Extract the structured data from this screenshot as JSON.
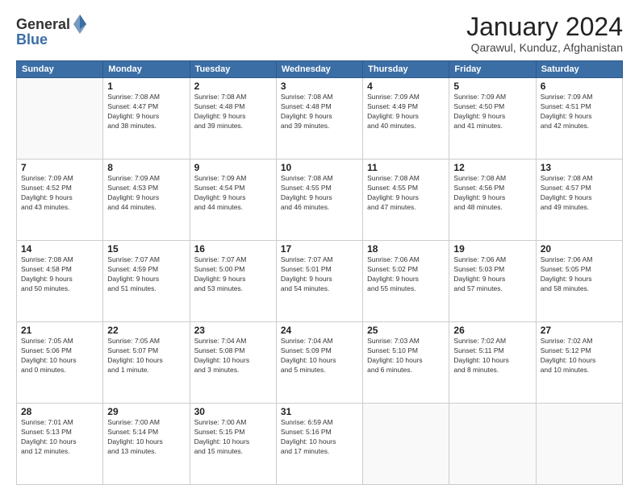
{
  "logo": {
    "general": "General",
    "blue": "Blue"
  },
  "title": "January 2024",
  "subtitle": "Qarawul, Kunduz, Afghanistan",
  "days_of_week": [
    "Sunday",
    "Monday",
    "Tuesday",
    "Wednesday",
    "Thursday",
    "Friday",
    "Saturday"
  ],
  "weeks": [
    [
      {
        "day": "",
        "info": ""
      },
      {
        "day": "1",
        "info": "Sunrise: 7:08 AM\nSunset: 4:47 PM\nDaylight: 9 hours\nand 38 minutes."
      },
      {
        "day": "2",
        "info": "Sunrise: 7:08 AM\nSunset: 4:48 PM\nDaylight: 9 hours\nand 39 minutes."
      },
      {
        "day": "3",
        "info": "Sunrise: 7:08 AM\nSunset: 4:48 PM\nDaylight: 9 hours\nand 39 minutes."
      },
      {
        "day": "4",
        "info": "Sunrise: 7:09 AM\nSunset: 4:49 PM\nDaylight: 9 hours\nand 40 minutes."
      },
      {
        "day": "5",
        "info": "Sunrise: 7:09 AM\nSunset: 4:50 PM\nDaylight: 9 hours\nand 41 minutes."
      },
      {
        "day": "6",
        "info": "Sunrise: 7:09 AM\nSunset: 4:51 PM\nDaylight: 9 hours\nand 42 minutes."
      }
    ],
    [
      {
        "day": "7",
        "info": "Sunrise: 7:09 AM\nSunset: 4:52 PM\nDaylight: 9 hours\nand 43 minutes."
      },
      {
        "day": "8",
        "info": "Sunrise: 7:09 AM\nSunset: 4:53 PM\nDaylight: 9 hours\nand 44 minutes."
      },
      {
        "day": "9",
        "info": "Sunrise: 7:09 AM\nSunset: 4:54 PM\nDaylight: 9 hours\nand 44 minutes."
      },
      {
        "day": "10",
        "info": "Sunrise: 7:08 AM\nSunset: 4:55 PM\nDaylight: 9 hours\nand 46 minutes."
      },
      {
        "day": "11",
        "info": "Sunrise: 7:08 AM\nSunset: 4:55 PM\nDaylight: 9 hours\nand 47 minutes."
      },
      {
        "day": "12",
        "info": "Sunrise: 7:08 AM\nSunset: 4:56 PM\nDaylight: 9 hours\nand 48 minutes."
      },
      {
        "day": "13",
        "info": "Sunrise: 7:08 AM\nSunset: 4:57 PM\nDaylight: 9 hours\nand 49 minutes."
      }
    ],
    [
      {
        "day": "14",
        "info": "Sunrise: 7:08 AM\nSunset: 4:58 PM\nDaylight: 9 hours\nand 50 minutes."
      },
      {
        "day": "15",
        "info": "Sunrise: 7:07 AM\nSunset: 4:59 PM\nDaylight: 9 hours\nand 51 minutes."
      },
      {
        "day": "16",
        "info": "Sunrise: 7:07 AM\nSunset: 5:00 PM\nDaylight: 9 hours\nand 53 minutes."
      },
      {
        "day": "17",
        "info": "Sunrise: 7:07 AM\nSunset: 5:01 PM\nDaylight: 9 hours\nand 54 minutes."
      },
      {
        "day": "18",
        "info": "Sunrise: 7:06 AM\nSunset: 5:02 PM\nDaylight: 9 hours\nand 55 minutes."
      },
      {
        "day": "19",
        "info": "Sunrise: 7:06 AM\nSunset: 5:03 PM\nDaylight: 9 hours\nand 57 minutes."
      },
      {
        "day": "20",
        "info": "Sunrise: 7:06 AM\nSunset: 5:05 PM\nDaylight: 9 hours\nand 58 minutes."
      }
    ],
    [
      {
        "day": "21",
        "info": "Sunrise: 7:05 AM\nSunset: 5:06 PM\nDaylight: 10 hours\nand 0 minutes."
      },
      {
        "day": "22",
        "info": "Sunrise: 7:05 AM\nSunset: 5:07 PM\nDaylight: 10 hours\nand 1 minute."
      },
      {
        "day": "23",
        "info": "Sunrise: 7:04 AM\nSunset: 5:08 PM\nDaylight: 10 hours\nand 3 minutes."
      },
      {
        "day": "24",
        "info": "Sunrise: 7:04 AM\nSunset: 5:09 PM\nDaylight: 10 hours\nand 5 minutes."
      },
      {
        "day": "25",
        "info": "Sunrise: 7:03 AM\nSunset: 5:10 PM\nDaylight: 10 hours\nand 6 minutes."
      },
      {
        "day": "26",
        "info": "Sunrise: 7:02 AM\nSunset: 5:11 PM\nDaylight: 10 hours\nand 8 minutes."
      },
      {
        "day": "27",
        "info": "Sunrise: 7:02 AM\nSunset: 5:12 PM\nDaylight: 10 hours\nand 10 minutes."
      }
    ],
    [
      {
        "day": "28",
        "info": "Sunrise: 7:01 AM\nSunset: 5:13 PM\nDaylight: 10 hours\nand 12 minutes."
      },
      {
        "day": "29",
        "info": "Sunrise: 7:00 AM\nSunset: 5:14 PM\nDaylight: 10 hours\nand 13 minutes."
      },
      {
        "day": "30",
        "info": "Sunrise: 7:00 AM\nSunset: 5:15 PM\nDaylight: 10 hours\nand 15 minutes."
      },
      {
        "day": "31",
        "info": "Sunrise: 6:59 AM\nSunset: 5:16 PM\nDaylight: 10 hours\nand 17 minutes."
      },
      {
        "day": "",
        "info": ""
      },
      {
        "day": "",
        "info": ""
      },
      {
        "day": "",
        "info": ""
      }
    ]
  ]
}
